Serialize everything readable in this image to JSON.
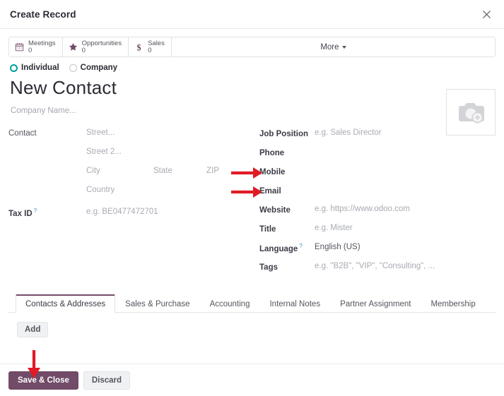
{
  "dialog": {
    "title": "Create Record",
    "close_icon": "close-icon"
  },
  "statbar": {
    "buttons": [
      {
        "icon": "calendar-icon",
        "label": "Meetings",
        "value": "0"
      },
      {
        "icon": "star-icon",
        "label": "Opportunities",
        "value": "0"
      },
      {
        "icon": "dollar-icon",
        "label": "Sales",
        "value": "0"
      }
    ],
    "more_label": "More"
  },
  "record_type": {
    "options": [
      {
        "label": "Individual",
        "selected": true
      },
      {
        "label": "Company",
        "selected": false
      }
    ]
  },
  "record": {
    "title": "New Contact",
    "company_name_placeholder": "Company Name...",
    "image_placeholder_icon": "camera-add-icon"
  },
  "left_fields": {
    "contact_label": "Contact",
    "street_placeholder": "Street...",
    "street2_placeholder": "Street 2...",
    "city_placeholder": "City",
    "state_placeholder": "State",
    "zip_placeholder": "ZIP",
    "country_placeholder": "Country",
    "tax_id_label": "Tax ID",
    "tax_id_help": "?",
    "tax_id_placeholder": "e.g. BE0477472701"
  },
  "right_fields": [
    {
      "label": "Job Position",
      "value": "e.g. Sales Director",
      "is_placeholder": true,
      "help": ""
    },
    {
      "label": "Phone",
      "value": "",
      "is_placeholder": true,
      "help": ""
    },
    {
      "label": "Mobile",
      "value": "",
      "is_placeholder": true,
      "help": ""
    },
    {
      "label": "Email",
      "value": "",
      "is_placeholder": true,
      "help": ""
    },
    {
      "label": "Website",
      "value": "e.g. https://www.odoo.com",
      "is_placeholder": true,
      "help": ""
    },
    {
      "label": "Title",
      "value": "e.g. Mister",
      "is_placeholder": true,
      "help": ""
    },
    {
      "label": "Language",
      "value": "English (US)",
      "is_placeholder": false,
      "help": "?"
    },
    {
      "label": "Tags",
      "value": "e.g. \"B2B\", \"VIP\", \"Consulting\", ...",
      "is_placeholder": true,
      "help": ""
    }
  ],
  "tabs": [
    {
      "label": "Contacts & Addresses",
      "active": true
    },
    {
      "label": "Sales & Purchase",
      "active": false
    },
    {
      "label": "Accounting",
      "active": false
    },
    {
      "label": "Internal Notes",
      "active": false
    },
    {
      "label": "Partner Assignment",
      "active": false
    },
    {
      "label": "Membership",
      "active": false
    }
  ],
  "tab_content": {
    "add_label": "Add"
  },
  "footer": {
    "save_label": "Save & Close",
    "discard_label": "Discard"
  },
  "colors": {
    "brand_purple": "#714b67",
    "radio_teal": "#00a09d",
    "annotation_red": "#e01b24",
    "help_blue": "#2d8dd4"
  },
  "annotations": [
    {
      "name": "arrow-to-mobile",
      "direction": "right"
    },
    {
      "name": "arrow-to-email",
      "direction": "right"
    },
    {
      "name": "arrow-to-save-close",
      "direction": "down"
    }
  ]
}
